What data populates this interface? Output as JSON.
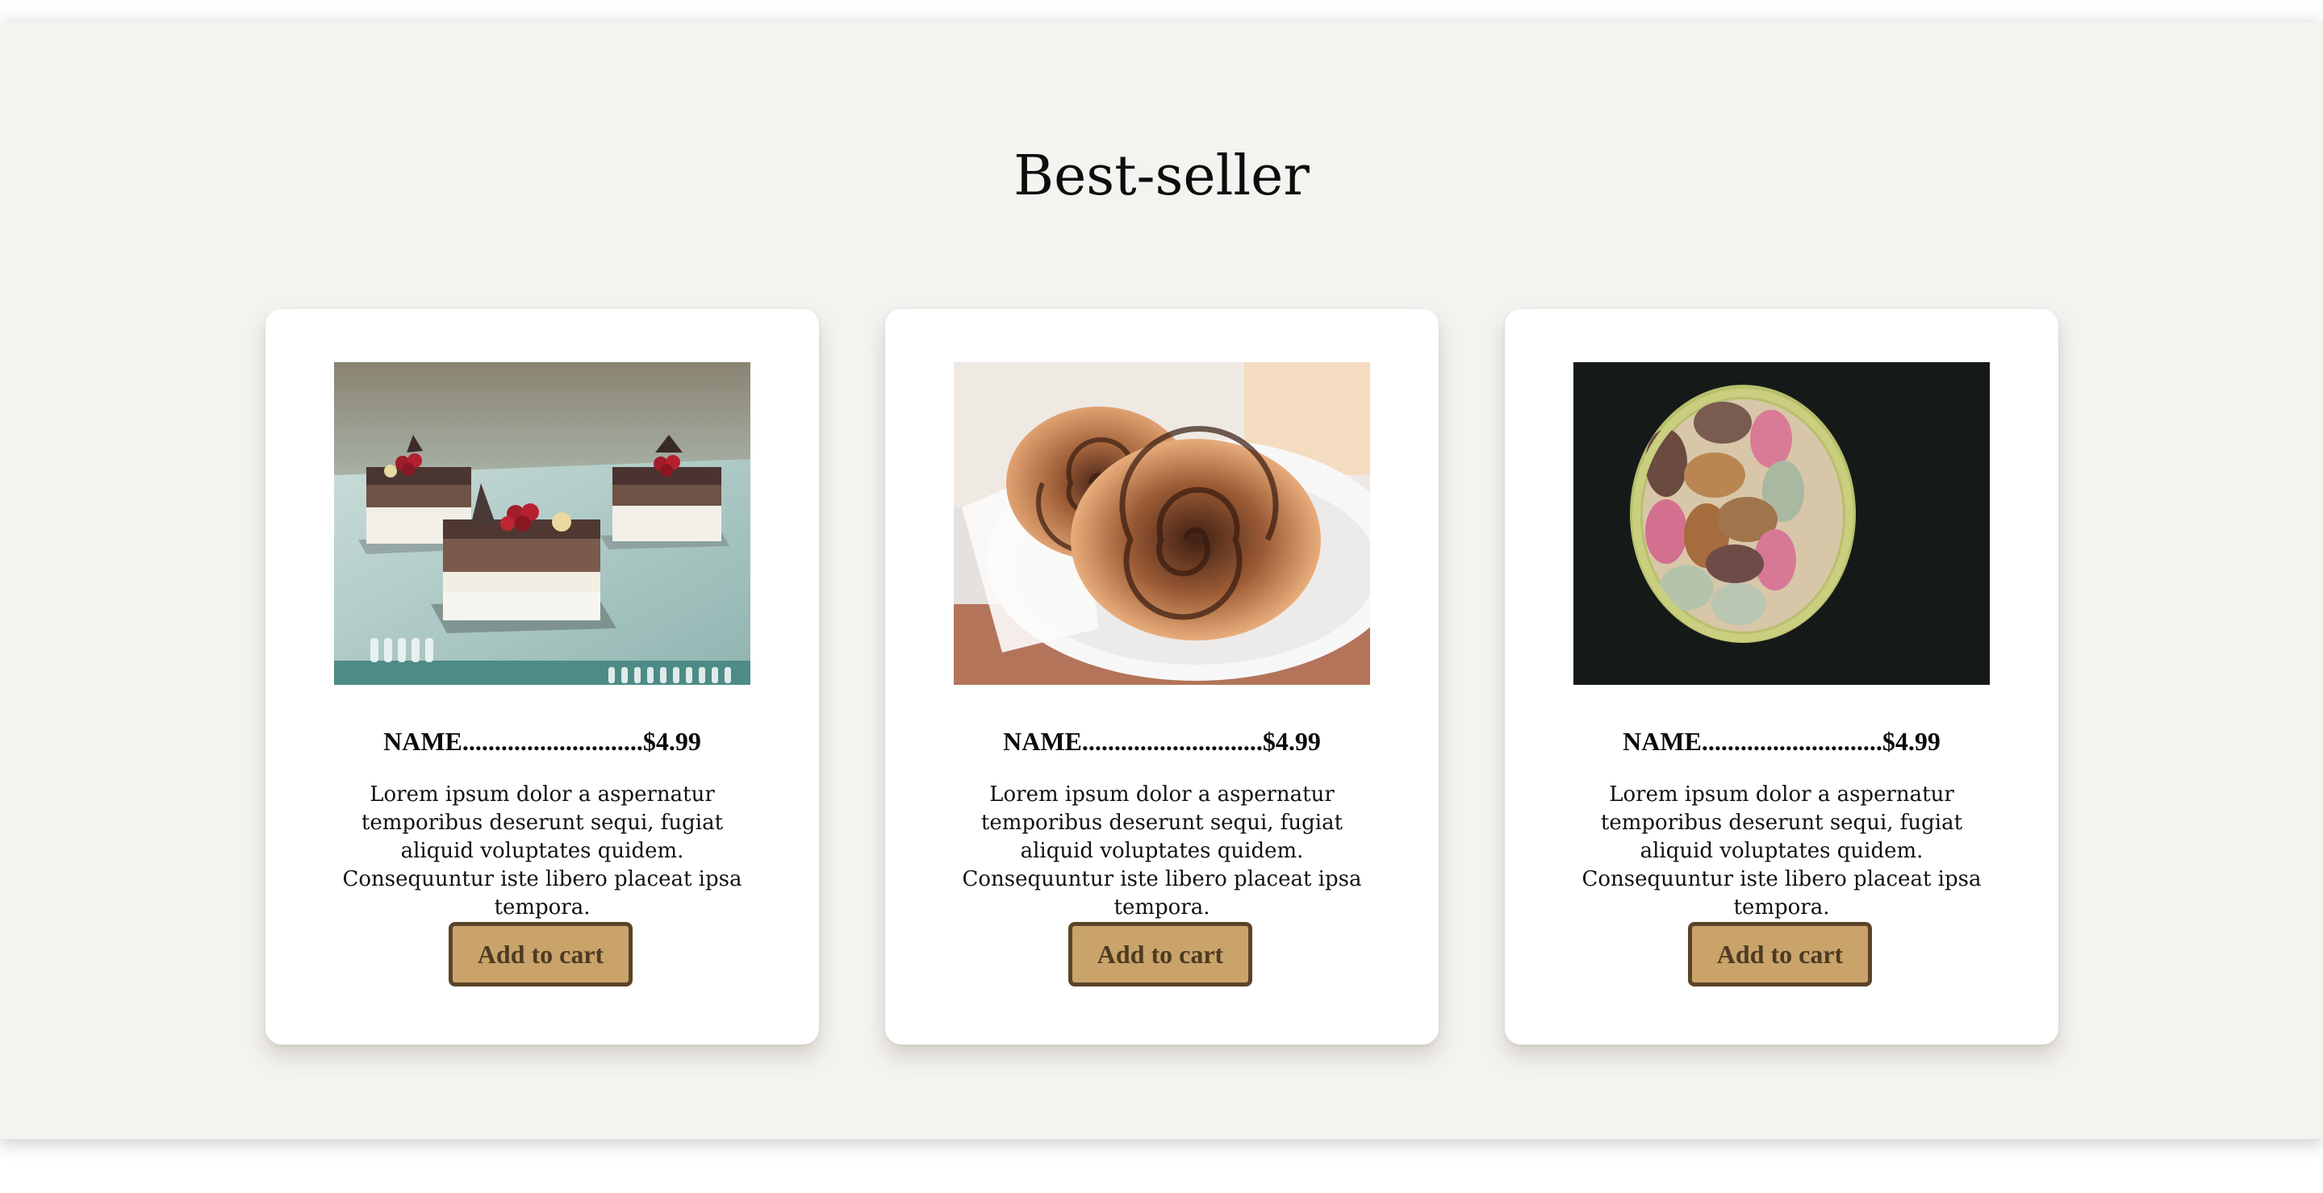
{
  "section": {
    "title": "Best-seller"
  },
  "products": [
    {
      "name": "NAME",
      "dots": "............................",
      "price": "$4.99",
      "description": "Lorem ipsum dolor a aspernatur temporibus deserunt sequi, fugiat aliquid voluptates quidem. Consequuntur iste libero placeat ipsa tempora.",
      "button_label": "Add to cart",
      "image": "layered-chocolate-cakes-photo"
    },
    {
      "name": "NAME",
      "dots": "............................",
      "price": "$4.99",
      "description": "Lorem ipsum dolor a aspernatur temporibus deserunt sequi, fugiat aliquid voluptates quidem. Consequuntur iste libero placeat ipsa tempora.",
      "button_label": "Add to cart",
      "image": "cinnamon-rolls-photo"
    },
    {
      "name": "NAME",
      "dots": "............................",
      "price": "$4.99",
      "description": "Lorem ipsum dolor a aspernatur temporibus deserunt sequi, fugiat aliquid voluptates quidem. Consequuntur iste libero placeat ipsa tempora.",
      "button_label": "Add to cart",
      "image": "macarons-bowl-photo"
    }
  ],
  "colors": {
    "section_background": "#f4f3f0",
    "card_background": "#ffffff",
    "button_fill": "#c9a36a",
    "button_border": "#5a4429",
    "button_text": "#4d3a22"
  }
}
